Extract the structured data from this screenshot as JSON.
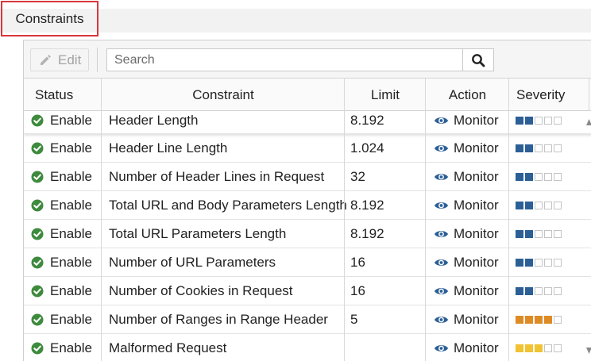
{
  "section": {
    "title": "Constraints"
  },
  "toolbar": {
    "edit_label": "Edit",
    "search_placeholder": "Search"
  },
  "columns": {
    "status": "Status",
    "constraint": "Constraint",
    "limit": "Limit",
    "action": "Action",
    "severity": "Severity"
  },
  "colors": {
    "check": "#3e8a3e",
    "sev_blue": "#2c5f96",
    "sev_orange": "#de8b25",
    "sev_yellow": "#f1c232",
    "sev_empty": "#ffffff"
  },
  "rows": [
    {
      "status": "Enable",
      "constraint": "Header Length",
      "limit": "8.192",
      "action": "Monitor",
      "severity": {
        "level": 2,
        "max": 5,
        "color": "blue"
      }
    },
    {
      "status": "Enable",
      "constraint": "Header Line Length",
      "limit": "1.024",
      "action": "Monitor",
      "severity": {
        "level": 2,
        "max": 5,
        "color": "blue"
      }
    },
    {
      "status": "Enable",
      "constraint": "Number of Header Lines in Request",
      "limit": "32",
      "action": "Monitor",
      "severity": {
        "level": 2,
        "max": 5,
        "color": "blue"
      }
    },
    {
      "status": "Enable",
      "constraint": "Total URL and Body Parameters Length",
      "limit": "8.192",
      "action": "Monitor",
      "severity": {
        "level": 2,
        "max": 5,
        "color": "blue"
      }
    },
    {
      "status": "Enable",
      "constraint": "Total URL Parameters Length",
      "limit": "8.192",
      "action": "Monitor",
      "severity": {
        "level": 2,
        "max": 5,
        "color": "blue"
      }
    },
    {
      "status": "Enable",
      "constraint": "Number of URL Parameters",
      "limit": "16",
      "action": "Monitor",
      "severity": {
        "level": 2,
        "max": 5,
        "color": "blue"
      }
    },
    {
      "status": "Enable",
      "constraint": "Number of Cookies in Request",
      "limit": "16",
      "action": "Monitor",
      "severity": {
        "level": 2,
        "max": 5,
        "color": "blue"
      }
    },
    {
      "status": "Enable",
      "constraint": "Number of Ranges in Range Header",
      "limit": "5",
      "action": "Monitor",
      "severity": {
        "level": 4,
        "max": 5,
        "color": "orange"
      }
    },
    {
      "status": "Enable",
      "constraint": "Malformed Request",
      "limit": "",
      "action": "Monitor",
      "severity": {
        "level": 3,
        "max": 5,
        "color": "yellow"
      }
    }
  ]
}
